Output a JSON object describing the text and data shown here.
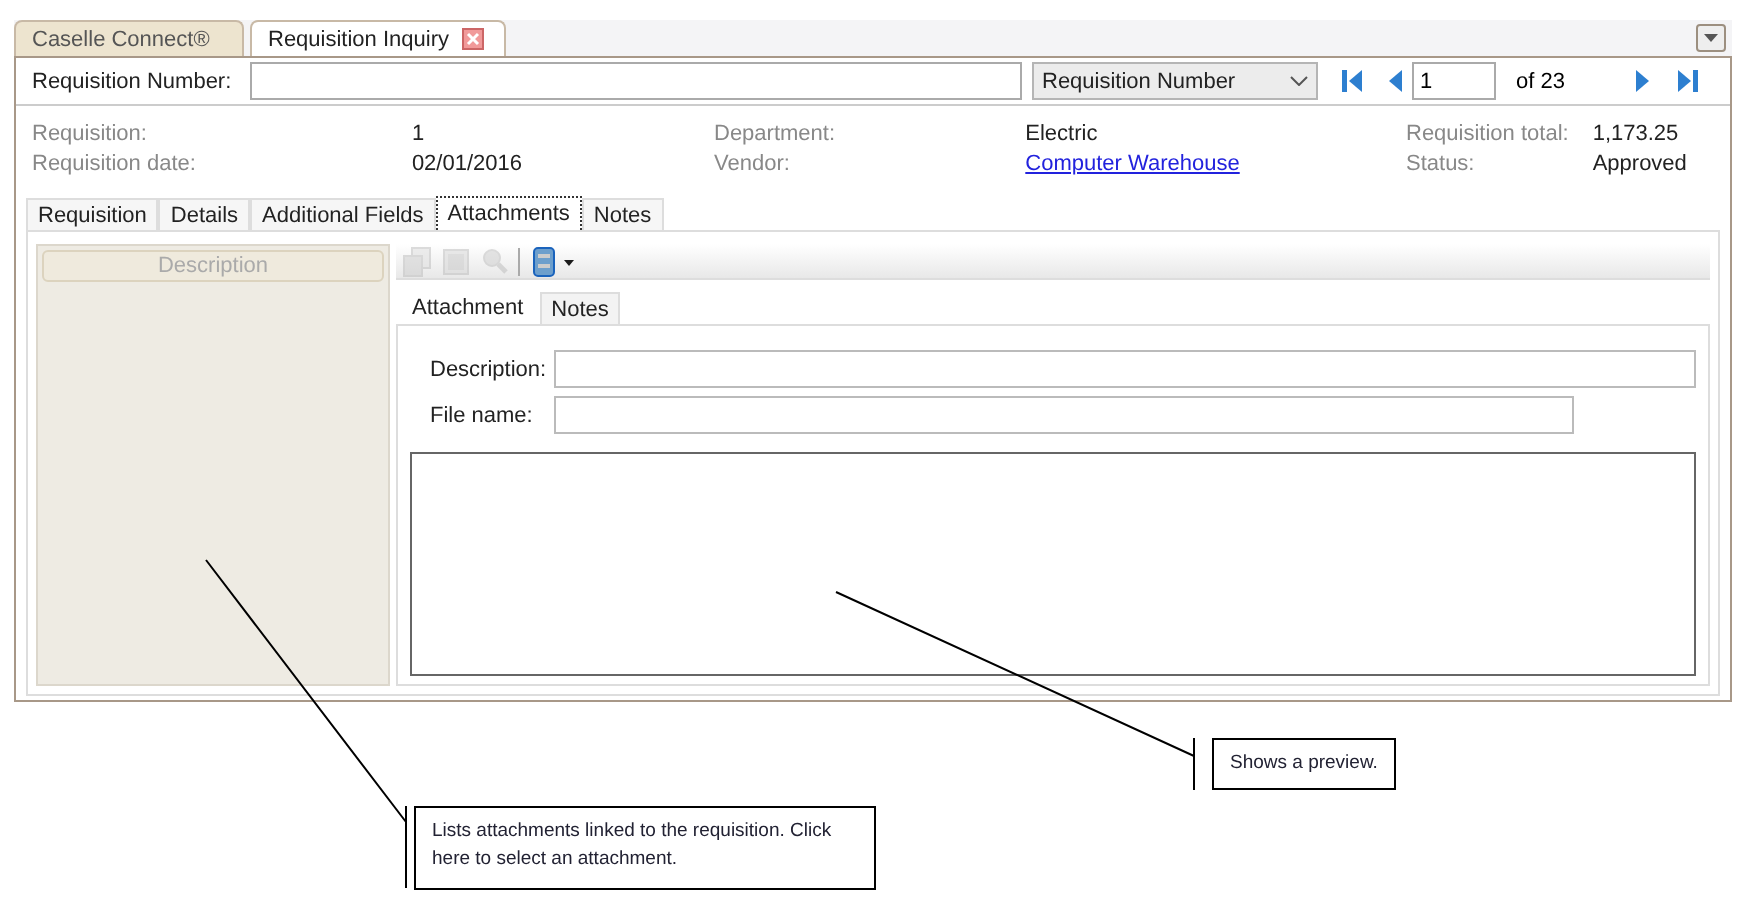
{
  "app_tabs": [
    {
      "label": "Caselle Connect®",
      "selected": false,
      "closable": false
    },
    {
      "label": "Requisition Inquiry",
      "selected": true,
      "closable": true
    }
  ],
  "search": {
    "label": "Requisition Number:",
    "search_by": "Requisition Number",
    "page": "1",
    "page_count": "of 23"
  },
  "summary_columns": [
    [
      {
        "label": "Requisition:",
        "value": "1",
        "kind": "text"
      },
      {
        "label": "Requisition date:",
        "value": "02/01/2016",
        "kind": "text"
      }
    ],
    [
      {
        "label": "Department:",
        "value": "Electric",
        "kind": "text"
      },
      {
        "label": "Vendor:",
        "value": "Computer Warehouse",
        "kind": "link"
      }
    ],
    [
      {
        "label": "Requisition total:",
        "value": "1,173.25",
        "kind": "text"
      },
      {
        "label": "Status:",
        "value": "Approved",
        "kind": "text"
      }
    ]
  ],
  "tabs": [
    {
      "label": "Requisition",
      "selected": false
    },
    {
      "label": "Details",
      "selected": false
    },
    {
      "label": "Additional Fields",
      "selected": false
    },
    {
      "label": "Attachments",
      "selected": true
    },
    {
      "label": "Notes",
      "selected": false
    }
  ],
  "attachments_list": {
    "column": "Description"
  },
  "toolbar": [
    {
      "kind": "copy",
      "disabled": true
    },
    {
      "kind": "frame",
      "disabled": true
    },
    {
      "kind": "zoom",
      "disabled": true
    },
    {
      "kind": "separator"
    },
    {
      "kind": "scan",
      "disabled": false
    }
  ],
  "detail_tabs": [
    {
      "label": "Attachment",
      "selected": true
    },
    {
      "label": "Notes",
      "selected": false
    }
  ],
  "fields": [
    {
      "label": "Description:",
      "kind": "long"
    },
    {
      "label": "File name:",
      "kind": "short"
    }
  ],
  "callouts": [
    {
      "text": "Shows a preview."
    },
    {
      "text": "Lists attachments linked to the requisition. Click here to select an attachment."
    }
  ]
}
